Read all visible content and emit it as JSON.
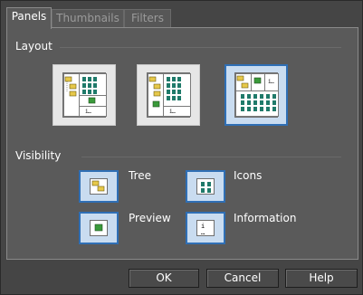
{
  "tabs": [
    {
      "label": "Panels",
      "active": true
    },
    {
      "label": "Thumbnails",
      "active": false
    },
    {
      "label": "Filters",
      "active": false
    }
  ],
  "layout": {
    "label": "Layout",
    "options": [
      {
        "name": "tree-left-layout",
        "selected": false
      },
      {
        "name": "tree-center-layout",
        "selected": false
      },
      {
        "name": "grid-bottom-layout",
        "selected": true
      }
    ]
  },
  "visibility": {
    "label": "Visibility",
    "items": [
      {
        "label": "Tree",
        "icon": "folder-tree-icon",
        "checked": true
      },
      {
        "label": "Icons",
        "icon": "icons-grid-icon",
        "checked": true
      },
      {
        "label": "Preview",
        "icon": "preview-icon",
        "checked": true
      },
      {
        "label": "Information",
        "icon": "information-icon",
        "checked": true
      }
    ]
  },
  "buttons": {
    "ok": "OK",
    "cancel": "Cancel",
    "help": "Help"
  },
  "colors": {
    "selected_border": "#2f6fb5",
    "selected_fill": "#c9dcf0",
    "dialog_background": "#454545",
    "thumbnail_dot": "#1f7a6a"
  }
}
